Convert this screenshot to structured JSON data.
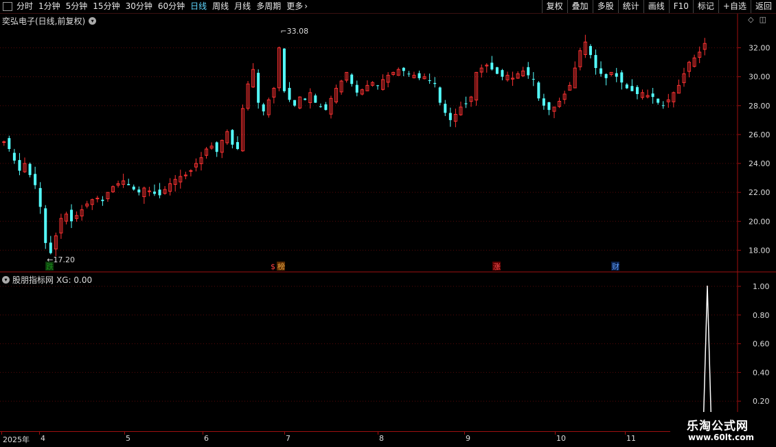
{
  "toolbar": {
    "periods": [
      "分时",
      "1分钟",
      "5分钟",
      "15分钟",
      "30分钟",
      "60分钟",
      "日线",
      "周线",
      "月线",
      "多周期",
      "更多"
    ],
    "active_period": "日线",
    "more_arrow": "›",
    "right_buttons": [
      "复权",
      "叠加",
      "多股",
      "统计",
      "画线",
      "F10",
      "标记",
      "+自选",
      "返回"
    ]
  },
  "main_chart": {
    "title": "奕弘电子(日线,前复权)",
    "expand_icon": "chevron-down-icon",
    "high_label": "33.08",
    "low_label": "17.20",
    "yticks": [
      "32.00",
      "30.00",
      "28.00",
      "26.00",
      "24.00",
      "22.00",
      "20.00",
      "18.00"
    ],
    "markers": [
      {
        "text": "跌",
        "color": "#1a8a1a",
        "bg": "#0c3a0c"
      },
      {
        "text": "$",
        "color": "#ff4040",
        "bg": "#000"
      },
      {
        "text": "榜",
        "color": "#e0a040",
        "bg": "#5a2a00"
      },
      {
        "text": "涨",
        "color": "#ff5050",
        "bg": "#5a0000"
      },
      {
        "text": "财",
        "color": "#60a0ff",
        "bg": "#0a1f4a"
      }
    ]
  },
  "sub_chart": {
    "title": "股朋指标网",
    "xg_label": "XG: 0.00",
    "yticks": [
      "1.00",
      "0.80",
      "0.60",
      "0.40",
      "0.20"
    ]
  },
  "x_axis": {
    "labels": [
      "2025年",
      "4",
      "5",
      "6",
      "7",
      "8",
      "9",
      "10",
      "11"
    ]
  },
  "watermark": {
    "line1": "乐淘公式网",
    "line2": "www.60lt.com"
  },
  "colors": {
    "up": "#ff3232",
    "down": "#54ffff",
    "grid": "#5a0a0a",
    "axis": "#a01010"
  },
  "chart_data": {
    "type": "candlestick",
    "title": "奕弘电子(日线,前复权)",
    "ylim": [
      16.5,
      33.5
    ],
    "high": 33.08,
    "low": 17.2,
    "approx_closes": [
      25.5,
      25.0,
      24.2,
      23.5,
      24.0,
      23.2,
      22.5,
      21.0,
      18.5,
      17.8,
      19.0,
      20.2,
      20.5,
      20.0,
      20.4,
      20.8,
      21.2,
      21.5,
      21.6,
      21.4,
      22.0,
      22.4,
      22.6,
      22.8,
      22.5,
      22.2,
      22.0,
      22.3,
      22.1,
      21.9,
      21.8,
      22.2,
      22.6,
      22.9,
      23.1,
      23.2,
      23.5,
      24.0,
      24.4,
      25.0,
      25.2,
      24.8,
      25.6,
      26.2,
      25.3,
      25.0,
      27.8,
      29.5,
      30.5,
      28.2,
      27.6,
      28.4,
      29.2,
      32.0,
      29.0,
      28.4,
      28.0,
      28.6,
      28.4,
      28.9,
      28.2,
      27.9,
      27.7,
      28.5,
      29.2,
      29.7,
      30.3,
      29.5,
      28.9,
      29.1,
      29.4,
      29.6,
      29.4,
      29.8,
      30.1,
      30.3,
      30.5,
      30.4,
      30.2,
      30.1,
      29.9,
      30.0,
      29.7,
      29.5,
      28.2,
      27.5,
      27.0,
      27.4,
      27.9,
      28.1,
      28.6,
      30.3,
      30.6,
      30.8,
      30.5,
      30.2,
      30.0,
      30.1,
      29.9,
      30.2,
      30.4,
      30.1,
      29.8,
      28.5,
      28.0,
      27.7,
      27.9,
      28.3,
      28.8,
      29.4,
      30.6,
      31.8,
      32.4,
      31.5,
      30.6,
      30.2,
      29.9,
      30.3,
      30.0,
      29.6,
      29.2,
      29.0,
      28.8,
      28.9,
      28.7,
      28.6,
      28.2,
      28.0,
      28.4,
      28.9,
      29.4,
      30.2,
      31.0,
      31.3,
      31.7,
      32.3
    ]
  }
}
